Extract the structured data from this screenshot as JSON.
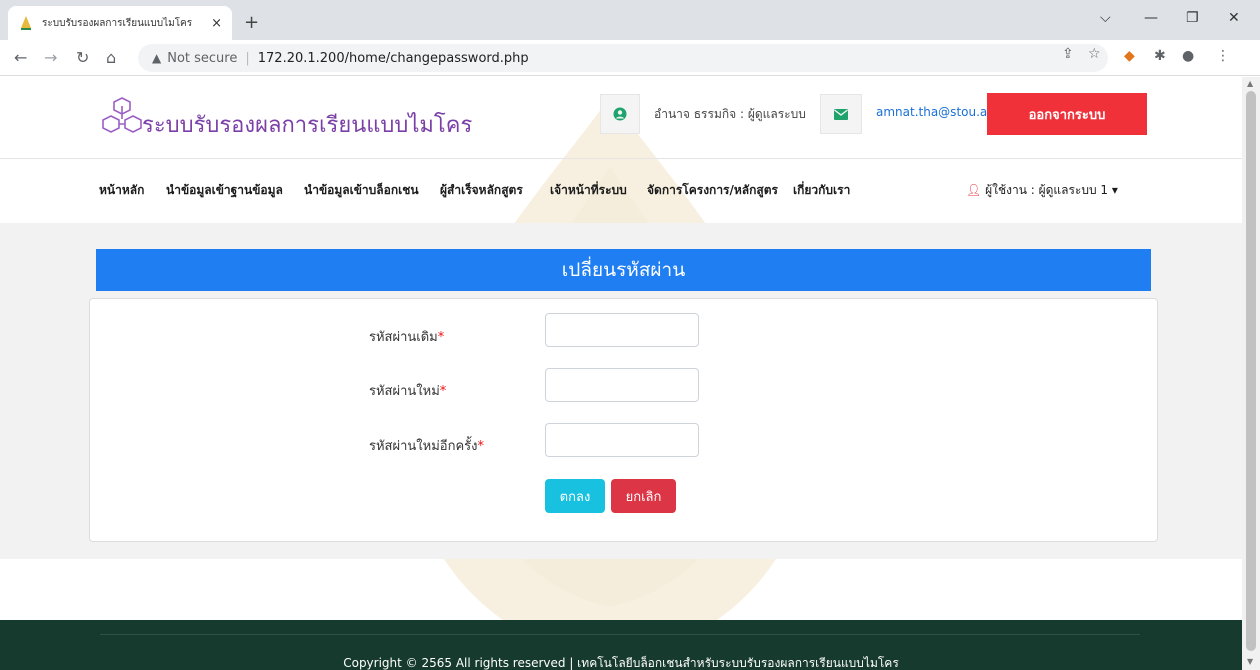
{
  "browser": {
    "tab_title": "ระบบรับรองผลการเรียนแบบไมโคร",
    "tab_close": "×",
    "new_tab": "+",
    "not_secure": "Not secure",
    "url": "172.20.1.200/home/changepassword.php"
  },
  "header": {
    "site_title": "ระบบรับรองผลการเรียนแบบไมโคร",
    "user_info": "อำนาจ ธรรมกิจ : ผู้ดูแลระบบ",
    "email": "amnat.tha@stou.ac.th",
    "logout_label": "ออกจากระบบ",
    "brand_color": "#7b3fa8",
    "logout_color": "#f0313a"
  },
  "nav": {
    "items": [
      "หน้าหลัก",
      "นำข้อมูลเข้าฐานข้อมูล",
      "นำข้อมูลเข้าบล็อกเชน",
      "ผู้สำเร็จหลักสูตร",
      "เจ้าหน้าที่ระบบ",
      "จัดการโครงการ/หลักสูตร",
      "เกี่ยวกับเรา"
    ],
    "user_menu": "ผู้ใช้งาน : ผู้ดูแลระบบ 1"
  },
  "form": {
    "title": "เปลี่ยนรหัสผ่าน",
    "fields": [
      {
        "label": "รหัสผ่านเดิม",
        "required": "*",
        "value": ""
      },
      {
        "label": "รหัสผ่านใหม่",
        "required": "*",
        "value": ""
      },
      {
        "label": "รหัสผ่านใหม่อีกครั้ง",
        "required": "*",
        "value": ""
      }
    ],
    "ok_label": "ตกลง",
    "cancel_label": "ยกเลิก",
    "title_color": "#1f7ff2"
  },
  "footer": {
    "text": "Copyright © 2565 All rights reserved | เทคโนโลยีบล็อกเชนสำหรับระบบรับรองผลการเรียนแบบไมโคร"
  },
  "icons": [
    "back-arrow-icon",
    "forward-arrow-icon",
    "reload-icon",
    "home-icon",
    "warning-icon",
    "share-icon",
    "star-icon",
    "extension-icon",
    "profile-icon",
    "menu-icon",
    "user-circle-icon",
    "envelope-icon",
    "user-icon",
    "caret-down-icon"
  ]
}
